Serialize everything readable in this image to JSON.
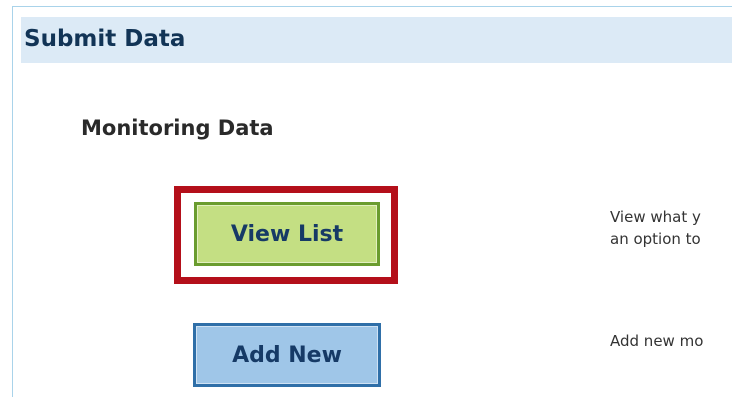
{
  "panel": {
    "title": "Submit Data"
  },
  "section": {
    "title": "Monitoring Data"
  },
  "actions": [
    {
      "label": "View List",
      "description_lines": [
        "View what y",
        "an option to"
      ],
      "color": "#c4df83",
      "highlighted": true,
      "highlight_color": "#b40f1a"
    },
    {
      "label": "Add New",
      "description_lines": [
        "Add new mo"
      ],
      "color": "#9fc6e8",
      "highlighted": false
    }
  ]
}
